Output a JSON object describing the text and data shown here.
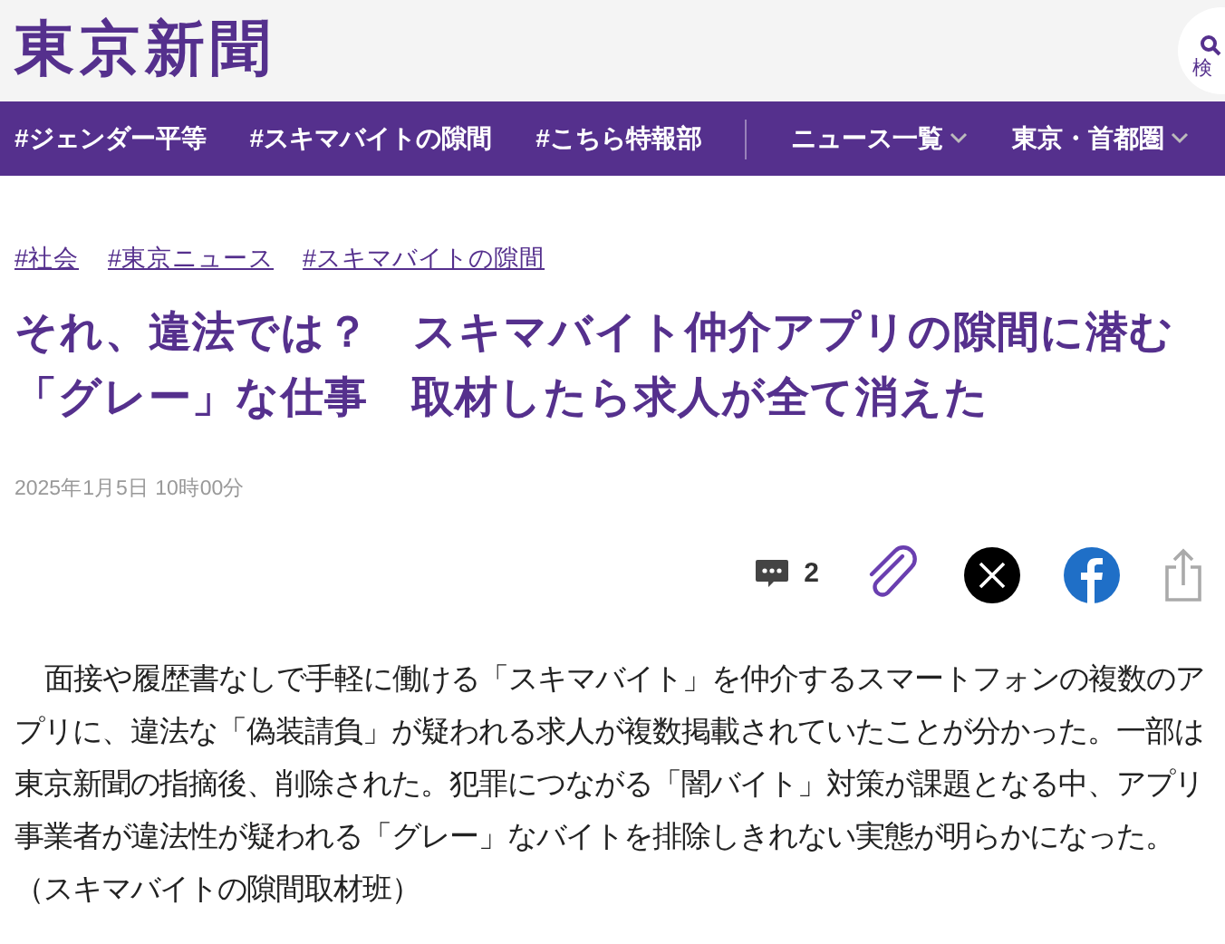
{
  "header": {
    "logo": "東京新聞",
    "search_label": "検"
  },
  "nav": [
    {
      "label": "#ジェンダー平等",
      "dropdown": false
    },
    {
      "label": "#スキマバイトの隙間",
      "dropdown": false
    },
    {
      "label": "#こちら特報部",
      "dropdown": false
    },
    {
      "label": "ニュース一覧",
      "dropdown": true
    },
    {
      "label": "東京・首都圏",
      "dropdown": true
    }
  ],
  "tags": [
    "#社会",
    "#東京ニュース",
    "#スキマバイトの隙間"
  ],
  "title_lines": [
    "それ、違法では？　スキマバイト仲介アプリの隙間に潜む",
    "「グレー」な仕事　取材したら求人が全て消えた"
  ],
  "date": "2025年1月5日 10時00分",
  "share": {
    "comment_count": "2"
  },
  "article": {
    "paragraph": "面接や履歴書なしで手軽に働ける「スキマバイト」を仲介するスマートフォンの複数のアプリに、違法な「偽装請負」が疑われる求人が複数掲載されていたことが分かった。一部は東京新聞の指摘後、削除された。犯罪につながる「闇バイト」対策が課題となる中、アプリ事業者が違法性が疑われる「グレー」なバイトを排除しきれない実態が明らかになった。",
    "byline": "（スキマバイトの隙間取材班）"
  }
}
